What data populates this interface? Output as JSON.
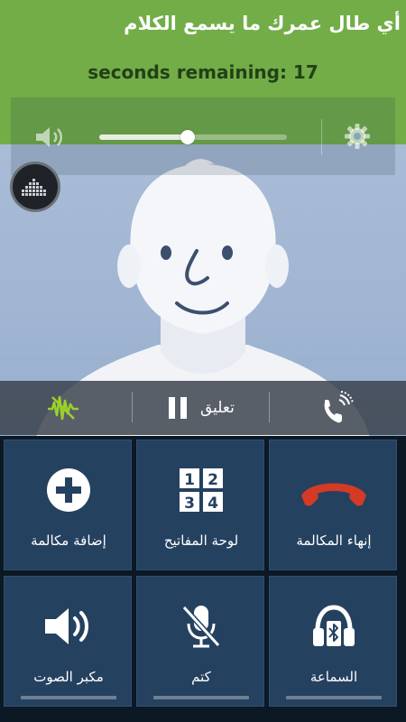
{
  "banner": {
    "title": "أي طال عمرك ما يسمع الكلام",
    "timer": "seconds remaining: 17",
    "color": "#72ad48"
  },
  "volume": {
    "level_percent": 47,
    "speaker_icon": "speaker-icon",
    "settings_icon": "gear-icon"
  },
  "floating_button": {
    "icon": "equalizer-icon"
  },
  "call_bar": {
    "noise_icon": "noise-reduction-icon",
    "hold_label": "تعليق",
    "hold_icon": "pause-icon",
    "receiver_icon": "call-receiver-icon"
  },
  "buttons": [
    {
      "label": "إضافة مكالمة",
      "icon": "add-call-icon"
    },
    {
      "label": "لوحة المفاتيح",
      "icon": "keypad-icon",
      "keys": [
        "1",
        "2",
        "3",
        "4"
      ]
    },
    {
      "label": "إنهاء المكالمة",
      "icon": "end-call-icon",
      "color": "#d43a25"
    },
    {
      "label": "مكبر الصوت",
      "icon": "speaker-icon"
    },
    {
      "label": "كتم",
      "icon": "mute-mic-icon"
    },
    {
      "label": "السماعة",
      "icon": "bluetooth-headset-icon"
    }
  ]
}
